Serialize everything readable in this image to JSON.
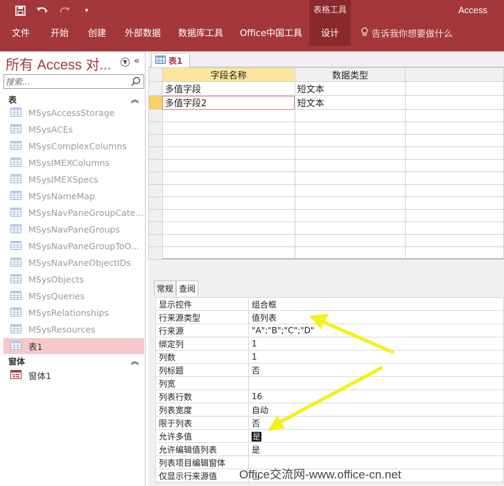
{
  "ribbon": {
    "contextual_group": "表格工具",
    "app_name": "Access",
    "menu": [
      "文件",
      "开始",
      "创建",
      "外部数据",
      "数据库工具",
      "Office中国工具",
      "设计"
    ],
    "tell_me": "告诉我你想要做什么"
  },
  "nav": {
    "title": "所有 Access 对...",
    "search_placeholder": "搜索...",
    "group_tables": "表",
    "tables": [
      "MSysAccessStorage",
      "MSysACEs",
      "MSysComplexColumns",
      "MSysIMEXColumns",
      "MSysIMEXSpecs",
      "MSysNameMap",
      "MSysNavPaneGroupCate...",
      "MSysNavPaneGroups",
      "MSysNavPaneGroupToO...",
      "MSysNavPaneObjectIDs",
      "MSysObjects",
      "MSysQueries",
      "MSysRelationships",
      "MSysResources",
      "表1"
    ],
    "group_forms": "窗体",
    "forms": [
      "窗体1"
    ]
  },
  "doc_tab": "表1",
  "design_grid": {
    "headers": [
      "字段名称",
      "数据类型"
    ],
    "rows": [
      {
        "name": "多值字段",
        "type": "短文本"
      },
      {
        "name": "多值字段2",
        "type": "短文本"
      }
    ]
  },
  "field_props": {
    "tabs": [
      "常规",
      "查阅"
    ],
    "rows": [
      {
        "label": "显示控件",
        "value": "组合框"
      },
      {
        "label": "行来源类型",
        "value": "值列表"
      },
      {
        "label": "行来源",
        "value": "\"A\";\"B\";\"C\";\"D\""
      },
      {
        "label": "绑定列",
        "value": "1"
      },
      {
        "label": "列数",
        "value": "1"
      },
      {
        "label": "列标题",
        "value": "否"
      },
      {
        "label": "列宽",
        "value": ""
      },
      {
        "label": "列表行数",
        "value": "16"
      },
      {
        "label": "列表宽度",
        "value": "自动"
      },
      {
        "label": "限于列表",
        "value": "否"
      },
      {
        "label": "允许多值",
        "value": "是"
      },
      {
        "label": "允许编辑值列表",
        "value": "是"
      },
      {
        "label": "列表项目编辑窗体",
        "value": ""
      },
      {
        "label": "仅显示行来源值",
        "value": "否"
      }
    ]
  },
  "annotation_color": "#f5f01a",
  "watermark": "Office交流网-www.office-cn.net"
}
